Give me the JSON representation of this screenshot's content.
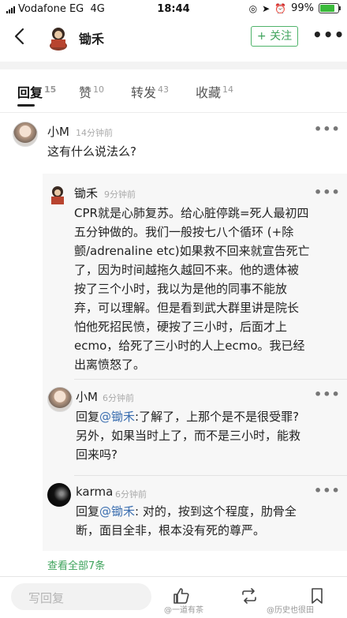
{
  "status_bar": {
    "carrier": "Vodafone EG",
    "network": "4G",
    "time": "18:44",
    "battery": "99%"
  },
  "nav": {
    "title": "锄禾",
    "follow_label": "+ 关注"
  },
  "tabs": [
    {
      "label": "回复",
      "count": "15"
    },
    {
      "label": "赞",
      "count": "10"
    },
    {
      "label": "转发",
      "count": "43"
    },
    {
      "label": "收藏",
      "count": "14"
    }
  ],
  "comment": {
    "author": "小M",
    "time": "14分钟前",
    "text": "这有什么说法么?"
  },
  "replies": [
    {
      "author": "锄禾",
      "time": "9分钟前",
      "lines": [
        "CPR就是心肺复苏。给心脏停跳=死人最初四",
        "五分钟做的。我们一般按七八个循环 (+除",
        "颤/adrenaline etc)如果救不回来就宣告死亡",
        "了，因为时间越拖久越回不来。他的遗体被",
        "按了三个小时，我以为是他的同事不能放",
        "弃，可以理解。但是看到武大群里讲是院长",
        "怕他死招民愤，硬按了三小时，后面才上",
        "ecmo，给死了三小时的人上ecmo。我已经",
        "出离愤怒了。"
      ]
    },
    {
      "author": "小M",
      "time": "6分钟前",
      "prefix": "回复",
      "mention": "@锄禾",
      "line1_rest": ":了解了，上那个是不是很受罪?",
      "lines": [
        "另外，如果当时上了，而不是三小时，能救",
        "回来吗?"
      ]
    },
    {
      "author": "karma",
      "time": "6分钟前",
      "prefix": "回复",
      "mention": "@锄禾",
      "line1_rest": ": 对的，按到这个程度，肋骨全",
      "lines": [
        "断，面目全非，根本没有死的尊严。"
      ]
    }
  ],
  "view_all": "查看全部7条",
  "bottom": {
    "reply_placeholder": "写回复"
  },
  "watermarks": [
    "@一道有茶",
    "@历史也很田"
  ],
  "colors": {
    "accent_green": "#3fa35c",
    "mention_blue": "#3c6fb0"
  }
}
